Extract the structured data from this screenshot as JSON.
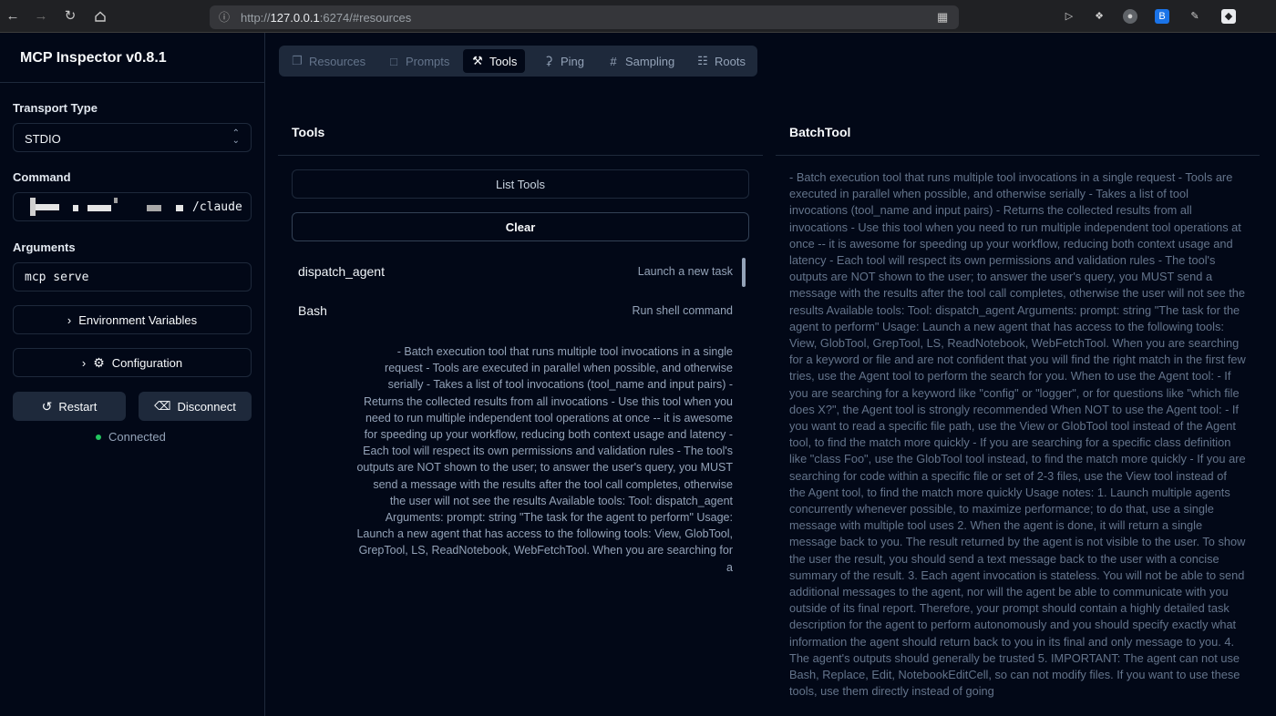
{
  "browser": {
    "url_prefix": "http://",
    "url_host": "127.0.0.1",
    "url_suffix": ":6274/#resources",
    "nav_icons": [
      "back-arrow-icon",
      "forward-arrow-icon",
      "reload-icon",
      "home-icon"
    ]
  },
  "sidebar": {
    "title": "MCP Inspector v0.8.1",
    "transport_label": "Transport Type",
    "transport_value": "STDIO",
    "command_label": "Command",
    "command_value": "/claude",
    "arguments_label": "Arguments",
    "arguments_value": "mcp serve",
    "env_button": "Environment Variables",
    "config_button": "Configuration",
    "restart_button": "Restart",
    "disconnect_button": "Disconnect",
    "status": "Connected",
    "status_color": "#22c55e"
  },
  "tabs": [
    {
      "label": "Resources",
      "icon": "files-icon",
      "state": "disabled"
    },
    {
      "label": "Prompts",
      "icon": "message-square-icon",
      "state": "disabled"
    },
    {
      "label": "Tools",
      "icon": "hammer-icon",
      "state": "active"
    },
    {
      "label": "Ping",
      "icon": "bell-icon",
      "state": "normal"
    },
    {
      "label": "Sampling",
      "icon": "hash-icon",
      "state": "normal"
    },
    {
      "label": "Roots",
      "icon": "folder-tree-icon",
      "state": "normal"
    }
  ],
  "tools_panel": {
    "title": "Tools",
    "list_button": "List Tools",
    "clear_button": "Clear",
    "tools": [
      {
        "name": "dispatch_agent",
        "description": "Launch a new task"
      },
      {
        "name": "Bash",
        "description": "Run shell command"
      }
    ],
    "expanded_description": "- Batch execution tool that runs multiple tool invocations in a single request - Tools are executed in parallel when possible, and otherwise serially - Takes a list of tool invocations (tool_name and input pairs) - Returns the collected results from all invocations - Use this tool when you need to run multiple independent tool operations at once -- it is awesome for speeding up your workflow, reducing both context usage and latency - Each tool will respect its own permissions and validation rules - The tool's outputs are NOT shown to the user; to answer the user's query, you MUST send a message with the results after the tool call completes, otherwise the user will not see the results Available tools: Tool: dispatch_agent Arguments: prompt: string \"The task for the agent to perform\" Usage: Launch a new agent that has access to the following tools: View, GlobTool, GrepTool, LS, ReadNotebook, WebFetchTool. When you are searching for a"
  },
  "detail_panel": {
    "title": "BatchTool",
    "description": "- Batch execution tool that runs multiple tool invocations in a single request - Tools are executed in parallel when possible, and otherwise serially - Takes a list of tool invocations (tool_name and input pairs) - Returns the collected results from all invocations - Use this tool when you need to run multiple independent tool operations at once -- it is awesome for speeding up your workflow, reducing both context usage and latency - Each tool will respect its own permissions and validation rules - The tool's outputs are NOT shown to the user; to answer the user's query, you MUST send a message with the results after the tool call completes, otherwise the user will not see the results Available tools: Tool: dispatch_agent Arguments: prompt: string \"The task for the agent to perform\" Usage: Launch a new agent that has access to the following tools: View, GlobTool, GrepTool, LS, ReadNotebook, WebFetchTool. When you are searching for a keyword or file and are not confident that you will find the right match in the first few tries, use the Agent tool to perform the search for you. When to use the Agent tool: - If you are searching for a keyword like \"config\" or \"logger\", or for questions like \"which file does X?\", the Agent tool is strongly recommended When NOT to use the Agent tool: - If you want to read a specific file path, use the View or GlobTool tool instead of the Agent tool, to find the match more quickly - If you are searching for a specific class definition like \"class Foo\", use the GlobTool tool instead, to find the match more quickly - If you are searching for code within a specific file or set of 2-3 files, use the View tool instead of the Agent tool, to find the match more quickly Usage notes: 1. Launch multiple agents concurrently whenever possible, to maximize performance; to do that, use a single message with multiple tool uses 2. When the agent is done, it will return a single message back to you. The result returned by the agent is not visible to the user. To show the user the result, you should send a text message back to the user with a concise summary of the result. 3. Each agent invocation is stateless. You will not be able to send additional messages to the agent, nor will the agent be able to communicate with you outside of its final report. Therefore, your prompt should contain a highly detailed task description for the agent to perform autonomously and you should specify exactly what information the agent should return back to you in its final and only message to you. 4. The agent's outputs should generally be trusted 5. IMPORTANT: The agent can not use Bash, Replace, Edit, NotebookEditCell, so can not modify files. If you want to use these tools, use them directly instead of going"
  }
}
